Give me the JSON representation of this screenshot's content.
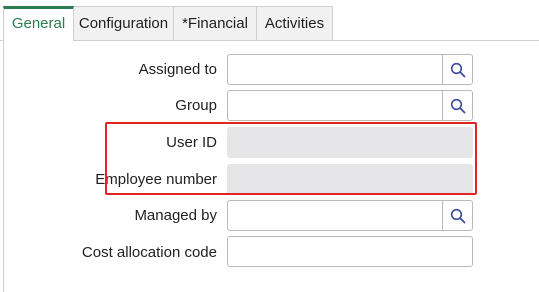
{
  "tabs": [
    {
      "label": "General",
      "active": true
    },
    {
      "label": "Configuration",
      "active": false
    },
    {
      "label": "*Financial",
      "active": false
    },
    {
      "label": "Activities",
      "active": false
    }
  ],
  "form": {
    "assigned_to": {
      "label": "Assigned to",
      "value": ""
    },
    "group": {
      "label": "Group",
      "value": ""
    },
    "user_id": {
      "label": "User ID",
      "value": ""
    },
    "employee_number": {
      "label": "Employee number",
      "value": ""
    },
    "managed_by": {
      "label": "Managed by",
      "value": ""
    },
    "cost_allocation_code": {
      "label": "Cost allocation code",
      "value": ""
    }
  },
  "icons": {
    "lookup": "search-icon"
  },
  "colors": {
    "active_tab": "#2e7d52",
    "highlight": "#e0241f",
    "readonly_field": "#e6e6e9",
    "search_icon": "#3b4aa0"
  }
}
